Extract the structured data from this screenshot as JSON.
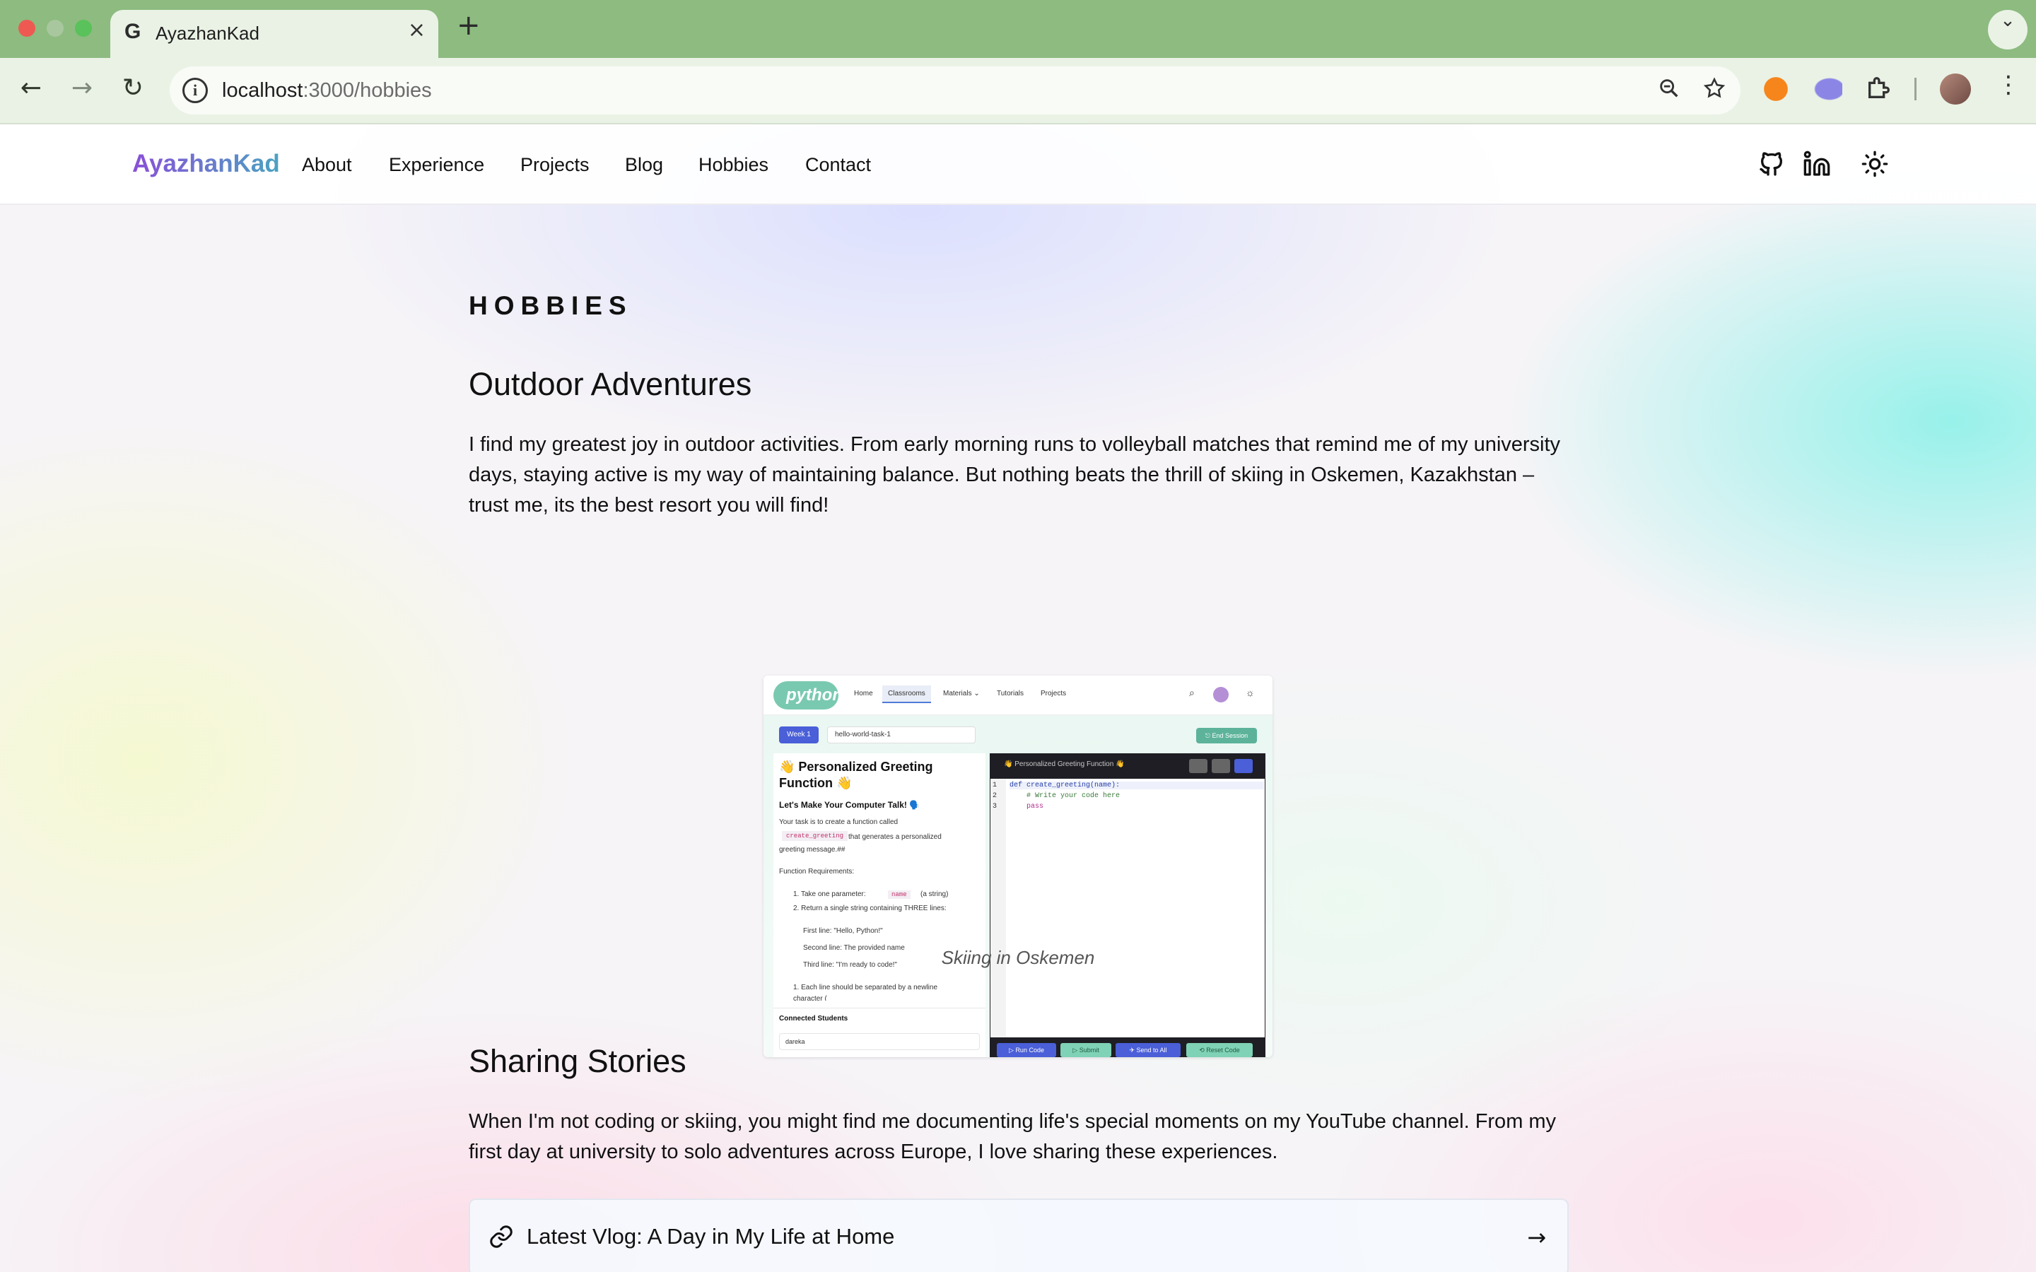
{
  "browser": {
    "tab_title": "AyazhanKad",
    "tab_favicon": "G",
    "url_host": "localhost",
    "url_rest": ":3000/hobbies"
  },
  "site": {
    "brand": "AyazhanKad",
    "nav": [
      "About",
      "Experience",
      "Projects",
      "Blog",
      "Hobbies",
      "Contact"
    ]
  },
  "page": {
    "heading": "HOBBIES",
    "section1": {
      "title": "Outdoor Adventures",
      "body": "I find my greatest joy in outdoor activities. From early morning runs to volleyball matches that remind me of my university days, staying active is my way of maintaining balance. But nothing beats the thrill of skiing in Oskemen, Kazakhstan – trust me, its the best resort you will find!"
    },
    "figure": {
      "caption": "Skiing in Oskemen",
      "app": {
        "logo": "python",
        "nav": [
          "Home",
          "Classrooms",
          "Materials ⌄",
          "Tutorials",
          "Projects"
        ],
        "week": "Week 1",
        "task_select": "hello-world-task-1",
        "end_session": "⎋ End Session",
        "task_title": "👋 Personalized Greeting Function 👋",
        "task_sub": "Let's Make Your Computer Talk! 🗣️",
        "task_line1": "Your task is to create a function called",
        "task_code": "create_greeting",
        "task_line2": "that generates a personalized greeting message.##",
        "req_title": "Function Requirements:",
        "req1": "1. Take one parameter:",
        "req1_code": "name",
        "req1_tail": "(a string)",
        "req2": "2. Return a single string containing THREE lines:",
        "bullets": [
          "First line: \"Hello, Python!\"",
          "Second line: The provided name",
          "Third line: \"I'm ready to code!\""
        ],
        "req3": "1. Each line should be separated by a newline",
        "req3_tail": "character (",
        "connected_title": "Connected Students",
        "student": "dareka",
        "editor_title": "👋 Personalized Greeting Function 👋",
        "code_lines": [
          "def create_greeting(name):",
          "    # Write your code here",
          "    pass"
        ],
        "buttons": [
          "▷ Run Code",
          "▷ Submit",
          "✈ Send to All",
          "⟲ Reset Code"
        ]
      }
    },
    "section2": {
      "title": "Sharing Stories",
      "body": "When I'm not coding or skiing, you might find me documenting life's special moments on my YouTube channel. From my first day at university to solo adventures across Europe, I love sharing these experiences."
    },
    "vlog": {
      "label": "Latest Vlog: A Day in My Life at Home"
    }
  }
}
